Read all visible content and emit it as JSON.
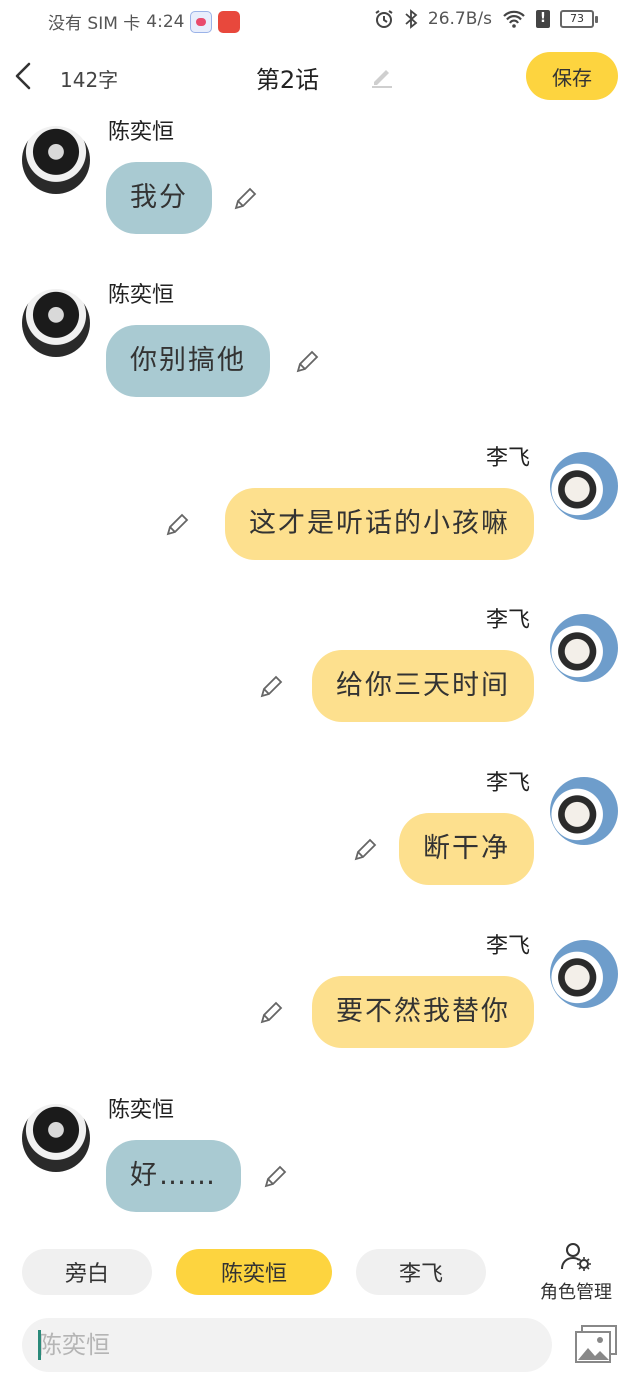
{
  "status_bar": {
    "carrier": "没有 SIM 卡",
    "time": "4:24",
    "network_speed": "26.7B/s",
    "battery": "73"
  },
  "header": {
    "word_count": "142字",
    "title": "第2话",
    "save_label": "保存"
  },
  "messages": [
    {
      "speaker": "陈奕恒",
      "side": "left",
      "text": "我分"
    },
    {
      "speaker": "陈奕恒",
      "side": "left",
      "text": "你别搞他"
    },
    {
      "speaker": "李飞",
      "side": "right",
      "text": "这才是听话的小孩嘛"
    },
    {
      "speaker": "李飞",
      "side": "right",
      "text": "给你三天时间"
    },
    {
      "speaker": "李飞",
      "side": "right",
      "text": "断干净"
    },
    {
      "speaker": "李飞",
      "side": "right",
      "text": "要不然我替你"
    },
    {
      "speaker": "陈奕恒",
      "side": "left",
      "text": "好……"
    }
  ],
  "roles": {
    "narrator": "旁白",
    "chen": "陈奕恒",
    "li": "李飞",
    "selected": "陈奕恒",
    "manage_label": "角色管理"
  },
  "input": {
    "placeholder": "陈奕恒"
  },
  "colors": {
    "accent": "#fdd43f",
    "left_bubble": "#a9cad2",
    "right_bubble": "#fde08e"
  },
  "icons": {
    "back": "chevron-left-icon",
    "edit": "pencil-icon",
    "role_manage": "user-gear-icon",
    "image": "image-icon"
  }
}
